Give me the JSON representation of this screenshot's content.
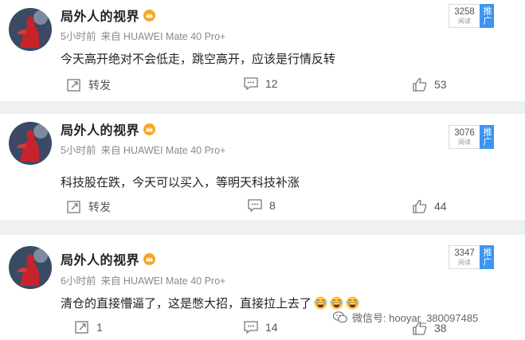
{
  "posts": [
    {
      "author": "局外人的视界",
      "time": "5小时前",
      "source": "来自 HUAWEI Mate 40 Pro+",
      "text": "今天高开绝对不会低走，跳空高开，应该是行情反转",
      "reads": "3258",
      "reads_label": "阅读",
      "push_label": "推广",
      "repost": "转发",
      "comments": "12",
      "likes": "53"
    },
    {
      "author": "局外人的视界",
      "time": "5小时前",
      "source": "来自 HUAWEI Mate 40 Pro+",
      "text": "科技股在跌，今天可以买入，等明天科技补涨",
      "reads": "3076",
      "reads_label": "阅读",
      "push_label": "推广",
      "repost": "转发",
      "comments": "8",
      "likes": "44"
    },
    {
      "author": "局外人的视界",
      "time": "6小时前",
      "source": "来自 HUAWEI Mate 40 Pro+",
      "text": "清仓的直接懵逼了，这是憋大招，直接拉上去了",
      "reads": "3347",
      "reads_label": "阅读",
      "push_label": "推广",
      "repost": "1",
      "comments": "14",
      "likes": "38"
    }
  ],
  "watermark": "微信号: hooyar_380097485",
  "colors": {
    "push_blue": "#3d95f0",
    "crown_gold": "#f5a623"
  }
}
